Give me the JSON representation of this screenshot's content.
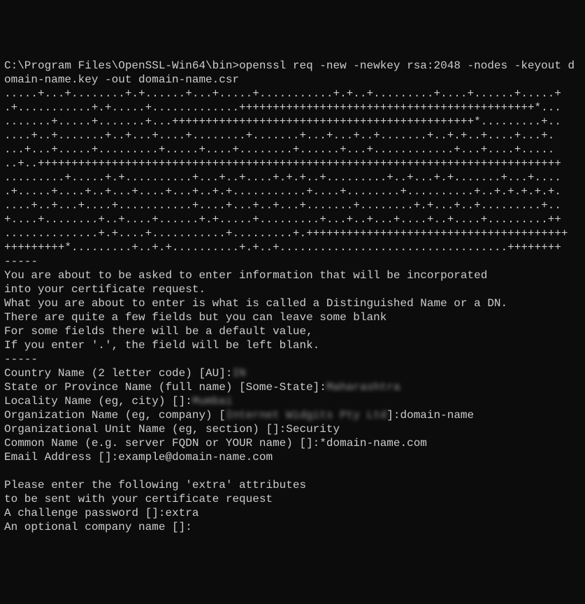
{
  "prompt_path": "C:\\Program Files\\OpenSSL-Win64\\bin>",
  "command": "openssl req -new -newkey rsa:2048 -nodes -keyout domain-name.key -out domain-name.csr",
  "keygen_lines": [
    ".....+...+........+.+......+...+.....+...........+.+..+.........+....+......+.....+",
    ".+...........+.+.....+.............++++++++++++++++++++++++++++++++++++++++++++*...",
    ".......+.....+.......+...+++++++++++++++++++++++++++++++++++++++++++++*.........+..",
    "....+..+.......+..+...+....+........+.......+...+...+..+.......+..+.+..+....+...+.",
    "...+...+.....+.........+.....+....+........+......+...+............+...+....+.....",
    "..+..++++++++++++++++++++++++++++++++++++++++++++++++++++++++++++++++++++++++++++++",
    ".........+.....+.+..........+...+..+....+.+.+..+.........+..+...+.+.......+...+....",
    ".+.....+....+..+...+....+...+..+.+...........+....+........+..........+..+.+.+.+.+.",
    "....+..+...+....+...........+....+...+..+...+.......+........+.+...+..+.........+..",
    "+....+........+..+....+......+.+.....+.........+...+..+...+....+..+....+.........++",
    "..............+.+....+...........+.........+.+++++++++++++++++++++++++++++++++++++++",
    "+++++++++*.........+..+.+..........+.+..+..................................++++++++",
    "-----"
  ],
  "info_lines": [
    "You are about to be asked to enter information that will be incorporated",
    "into your certificate request.",
    "What you are about to enter is what is called a Distinguished Name or a DN.",
    "There are quite a few fields but you can leave some blank",
    "For some fields there will be a default value,",
    "If you enter '.', the field will be left blank.",
    "-----"
  ],
  "fields": {
    "country": {
      "prompt": "Country Name (2 letter code) [AU]:",
      "value_blurred": "IN"
    },
    "state": {
      "prompt": "State or Province Name (full name) [Some-State]:",
      "value_blurred": "Maharashtra"
    },
    "locality": {
      "prompt": "Locality Name (eg, city) []:",
      "value_blurred": "Mumbai"
    },
    "org": {
      "prompt_prefix": "Organization Name (eg, company) [",
      "default_blurred": "Internet Widgits Pty Ltd",
      "prompt_suffix": "]:",
      "value": "domain-name"
    },
    "ou": {
      "prompt": "Organizational Unit Name (eg, section) []:",
      "value": "Security"
    },
    "cn": {
      "prompt": "Common Name (e.g. server FQDN or YOUR name) []:",
      "value": "*domain-name.com"
    },
    "email": {
      "prompt": "Email Address []:",
      "value": "example@domain-name.com"
    }
  },
  "extra_heading": "Please enter the following 'extra' attributes",
  "extra_sub": "to be sent with your certificate request",
  "challenge": {
    "prompt": "A challenge password []:",
    "value": "extra"
  },
  "optional_company": {
    "prompt": "An optional company name []:",
    "value": ""
  }
}
